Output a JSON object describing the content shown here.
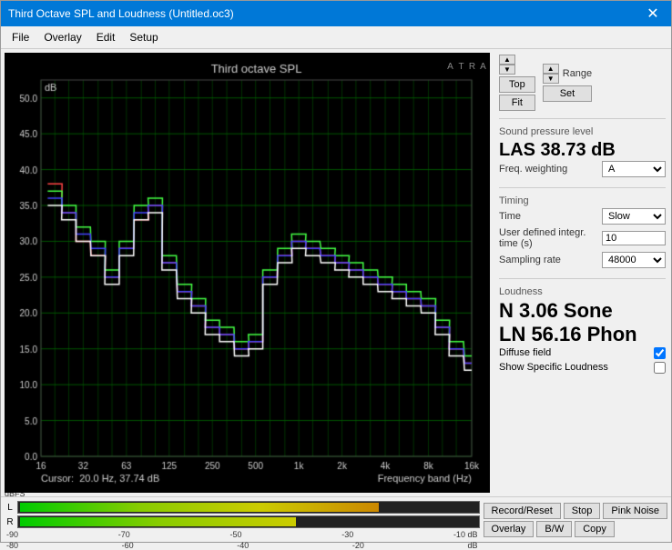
{
  "window": {
    "title": "Third Octave SPL and Loudness (Untitled.oc3)",
    "close_label": "✕"
  },
  "menu": {
    "items": [
      "File",
      "Overlay",
      "Edit",
      "Setup"
    ]
  },
  "nav": {
    "top_label": "Top",
    "fit_label": "Fit",
    "range_label": "Range",
    "set_label": "Set"
  },
  "spl": {
    "section_label": "Sound pressure level",
    "value": "LAS 38.73 dB",
    "freq_weighting_label": "Freq. weighting",
    "freq_weighting_value": "A"
  },
  "timing": {
    "section_label": "Timing",
    "time_label": "Time",
    "time_value": "Slow",
    "user_integr_label": "User defined integr. time (s)",
    "user_integr_value": "10",
    "sampling_rate_label": "Sampling rate",
    "sampling_rate_value": "48000"
  },
  "loudness": {
    "section_label": "Loudness",
    "n_value": "N 3.06 Sone",
    "ln_value": "LN 56.16 Phon",
    "diffuse_field_label": "Diffuse field",
    "diffuse_field_checked": true,
    "show_specific_label": "Show Specific Loudness",
    "show_specific_checked": false
  },
  "chart": {
    "title": "Third octave SPL",
    "db_label": "dB",
    "cursor_info": "Cursor:  20.0 Hz, 37.74 dB",
    "freq_label": "Frequency band (Hz)",
    "arta_label": "A\nR\nT\nA",
    "y_axis": [
      "50.0",
      "45.0",
      "40.0",
      "35.0",
      "30.0",
      "25.0",
      "20.0",
      "15.0",
      "10.0",
      "5.0",
      "0.0"
    ],
    "x_axis": [
      "16",
      "32",
      "63",
      "125",
      "250",
      "500",
      "1k",
      "2k",
      "4k",
      "8k",
      "16k"
    ]
  },
  "bottom": {
    "meter_l_label": "L",
    "meter_r_label": "R",
    "ticks": [
      "-90",
      "-70",
      "-50",
      "-30",
      "-10 dB"
    ],
    "ticks2": [
      "-80",
      "-60",
      "-40",
      "-20",
      "dB"
    ],
    "buttons_row1": [
      "Record/Reset",
      "Stop",
      "Pink Noise"
    ],
    "buttons_row2": [
      "Overlay",
      "B/W",
      "Copy"
    ]
  }
}
